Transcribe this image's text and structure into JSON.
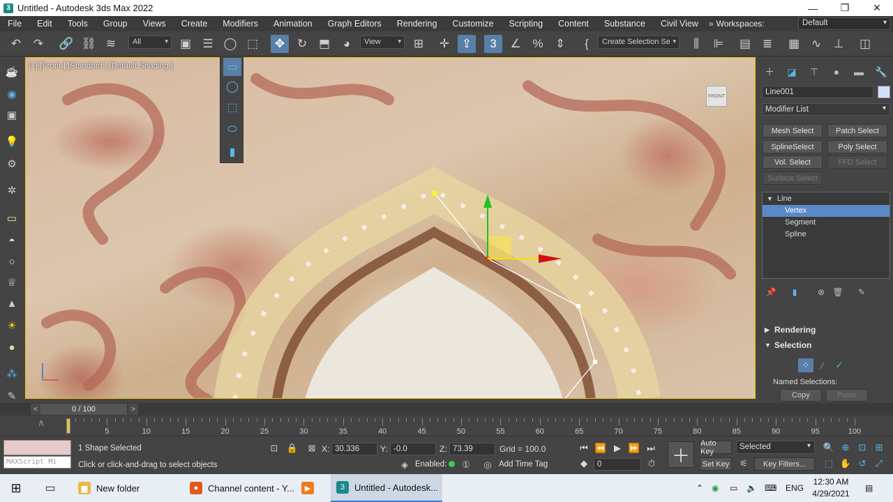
{
  "window": {
    "title": "Untitled - Autodesk 3ds Max 2022",
    "app_icon": "3",
    "controls": [
      "—",
      "❐",
      "✕"
    ]
  },
  "menu": {
    "items": [
      "File",
      "Edit",
      "Tools",
      "Group",
      "Views",
      "Create",
      "Modifiers",
      "Animation",
      "Graph Editors",
      "Rendering",
      "Customize",
      "Scripting",
      "Content",
      "Substance",
      "Civil View"
    ],
    "more": "»",
    "workspaces_label": "Workspaces:",
    "workspaces_value": "Default"
  },
  "toolbar": {
    "filter_select": "All",
    "ref_coord_select": "View",
    "named_selection_select": "Create Selection Se"
  },
  "viewport": {
    "label": "[+] [Front ] [Standard ] [Default Shading ]",
    "viewcube_label": "FRONT"
  },
  "command_panel": {
    "object_name": "Line001",
    "object_color": "#cfe0ff",
    "modifier_list": "Modifier List",
    "modifier_buttons": [
      {
        "label": "Mesh Select",
        "enabled": true
      },
      {
        "label": "Patch Select",
        "enabled": true
      },
      {
        "label": "SplineSelect",
        "enabled": true
      },
      {
        "label": "Poly Select",
        "enabled": true
      },
      {
        "label": "Vol. Select",
        "enabled": true
      },
      {
        "label": "FFD Select",
        "enabled": false
      },
      {
        "label": "Surface Select",
        "enabled": false
      }
    ],
    "stack": {
      "root": "Line",
      "items": [
        "Vertex",
        "Segment",
        "Spline"
      ],
      "selected": "Vertex"
    },
    "rollouts": {
      "rendering": "Rendering",
      "selection": "Selection"
    },
    "named_selections_label": "Named Selections:",
    "copy_label": "Copy",
    "paste_label": "Paste"
  },
  "time_slider": {
    "frame_display": "0 / 100",
    "prev": "<",
    "next": ">"
  },
  "trackbar": {
    "ticks": [
      5,
      10,
      15,
      20,
      25,
      30,
      35,
      40,
      45,
      50,
      55,
      60,
      65,
      70,
      75,
      80,
      85,
      90,
      95,
      100
    ],
    "start": 0,
    "end": 100
  },
  "status": {
    "maxscript_placeholder": "MAXScript Mi",
    "selection_status": "1 Shape Selected",
    "prompt": "Click or click-and-drag to select objects",
    "x_label": "X:",
    "x_value": "30.336",
    "y_label": "Y:",
    "y_value": "-0.0",
    "z_label": "Z:",
    "z_value": "73.39",
    "grid": "Grid = 100.0",
    "enabled_label": "Enabled:",
    "add_time_tag": "Add Time Tag",
    "auto_key": "Auto Key",
    "set_key": "Set Key",
    "key_select": "Selected",
    "key_filters": "Key Filters...",
    "current_frame": "0"
  },
  "taskbar": {
    "apps": [
      {
        "label": "New folder",
        "color": "#e8b84a",
        "icon": "▆"
      },
      {
        "label": "Channel content - Y...",
        "color": "#e2591c",
        "icon": "●"
      },
      {
        "label": "",
        "color": "#f07a1a",
        "icon": "▶"
      },
      {
        "label": "Untitled - Autodesk...",
        "color": "#1a8a8a",
        "icon": "3"
      }
    ],
    "lang": "ENG",
    "time": "12:30 AM",
    "date": "4/29/2021"
  }
}
